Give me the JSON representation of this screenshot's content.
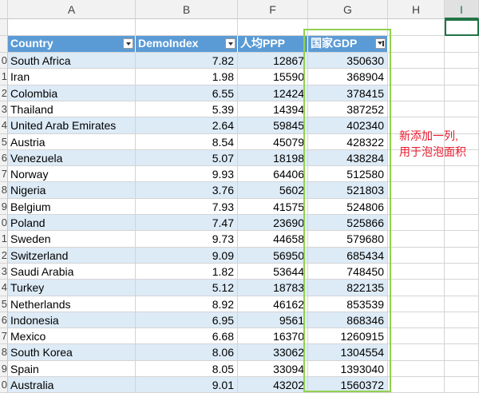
{
  "columns": [
    "A",
    "B",
    "F",
    "G",
    "H",
    "I"
  ],
  "headers": [
    "Country",
    "DemoIndex",
    "人均PPP",
    "国家GDP"
  ],
  "rows": [
    {
      "num": "0",
      "country": "South Africa",
      "demo": "7.82",
      "ppp": "12867",
      "gdp": "350630"
    },
    {
      "num": "1",
      "country": "Iran",
      "demo": "1.98",
      "ppp": "15590",
      "gdp": "368904"
    },
    {
      "num": "2",
      "country": "Colombia",
      "demo": "6.55",
      "ppp": "12424",
      "gdp": "378415"
    },
    {
      "num": "3",
      "country": "Thailand",
      "demo": "5.39",
      "ppp": "14394",
      "gdp": "387252"
    },
    {
      "num": "4",
      "country": "United Arab Emirates",
      "demo": "2.64",
      "ppp": "59845",
      "gdp": "402340"
    },
    {
      "num": "5",
      "country": "Austria",
      "demo": "8.54",
      "ppp": "45079",
      "gdp": "428322"
    },
    {
      "num": "6",
      "country": "Venezuela",
      "demo": "5.07",
      "ppp": "18198",
      "gdp": "438284"
    },
    {
      "num": "7",
      "country": "Norway",
      "demo": "9.93",
      "ppp": "64406",
      "gdp": "512580"
    },
    {
      "num": "8",
      "country": "Nigeria",
      "demo": "3.76",
      "ppp": "5602",
      "gdp": "521803"
    },
    {
      "num": "9",
      "country": "Belgium",
      "demo": "7.93",
      "ppp": "41575",
      "gdp": "524806"
    },
    {
      "num": "0",
      "country": "Poland",
      "demo": "7.47",
      "ppp": "23690",
      "gdp": "525866"
    },
    {
      "num": "1",
      "country": "Sweden",
      "demo": "9.73",
      "ppp": "44658",
      "gdp": "579680"
    },
    {
      "num": "2",
      "country": "Switzerland",
      "demo": "9.09",
      "ppp": "56950",
      "gdp": "685434"
    },
    {
      "num": "3",
      "country": "Saudi Arabia",
      "demo": "1.82",
      "ppp": "53644",
      "gdp": "748450"
    },
    {
      "num": "4",
      "country": "Turkey",
      "demo": "5.12",
      "ppp": "18783",
      "gdp": "822135"
    },
    {
      "num": "5",
      "country": "Netherlands",
      "demo": "8.92",
      "ppp": "46162",
      "gdp": "853539"
    },
    {
      "num": "6",
      "country": "Indonesia",
      "demo": "6.95",
      "ppp": "9561",
      "gdp": "868346"
    },
    {
      "num": "7",
      "country": "Mexico",
      "demo": "6.68",
      "ppp": "16370",
      "gdp": "1260915"
    },
    {
      "num": "8",
      "country": "South Korea",
      "demo": "8.06",
      "ppp": "33062",
      "gdp": "1304554"
    },
    {
      "num": "9",
      "country": "Spain",
      "demo": "8.05",
      "ppp": "33094",
      "gdp": "1393040"
    },
    {
      "num": "0",
      "country": "Australia",
      "demo": "9.01",
      "ppp": "43202",
      "gdp": "1560372"
    }
  ],
  "annotation": {
    "line1": "新添加一列,",
    "line2": "用于泡泡面积"
  },
  "colors": {
    "header": "#5b9bd5",
    "band": "#ddebf7",
    "highlight": "#92d050",
    "annotation": "#e8192c"
  }
}
